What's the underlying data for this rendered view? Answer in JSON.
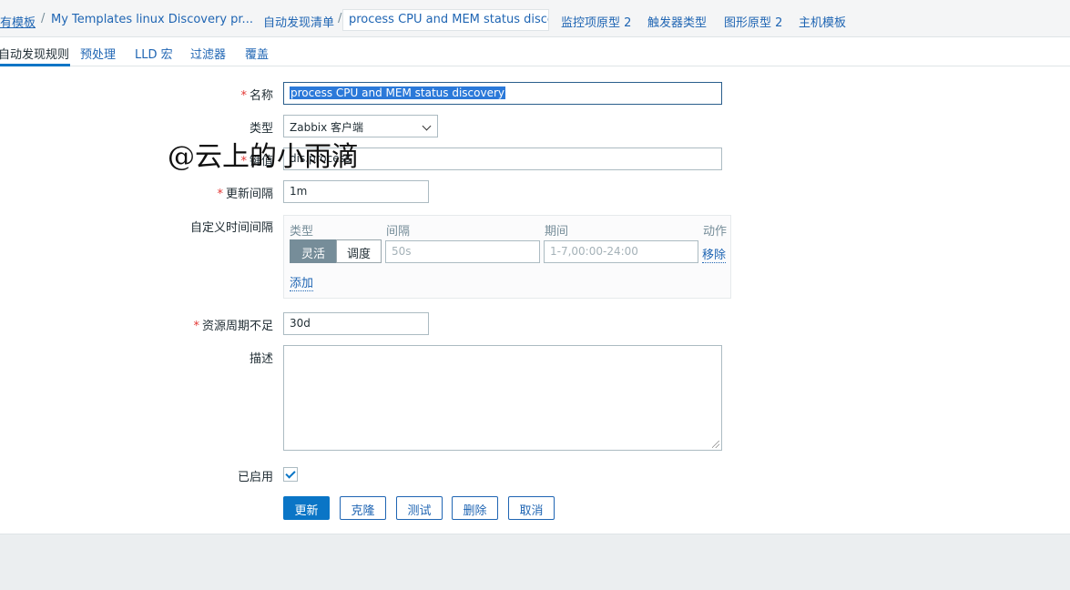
{
  "breadcrumb": {
    "all_templates": "有模板",
    "template": "My  Templates  linux  Discovery  pr...",
    "discovery_list": "自动发现清单",
    "current_rule": "process CPU and MEM status disco...",
    "item_prototypes": "监控项原型 2",
    "trigger_prototypes": "触发器类型",
    "graph_prototypes": "图形原型 2",
    "host_templates": "主机模板",
    "separator": "/"
  },
  "tabs": [
    {
      "label": "自动发现规则"
    },
    {
      "label": "预处理"
    },
    {
      "label": "LLD 宏"
    },
    {
      "label": "过滤器"
    },
    {
      "label": "覆盖"
    }
  ],
  "form": {
    "required_mark": "*",
    "name_label": "名称",
    "name_value": "process CPU and MEM status discovery",
    "type_label": "类型",
    "type_value": "Zabbix 客户端",
    "key_label": "键值",
    "key_value": "dis.process",
    "update_label": "更新间隔",
    "update_value": "1m",
    "custom_label": "自定义时间间隔",
    "custom_intervals": {
      "col_type": "类型",
      "col_interval": "间隔",
      "col_period": "期间",
      "col_action": "动作",
      "flexible": "灵活",
      "scheduling": "调度",
      "interval_placeholder": "50s",
      "period_placeholder": "1-7,00:00-24:00",
      "remove": "移除",
      "add": "添加"
    },
    "lifetime_label": "资源周期不足",
    "lifetime_value": "30d",
    "description_label": "描述",
    "description_value": "",
    "enabled_label": "已启用",
    "enabled": true
  },
  "buttons": {
    "update": "更新",
    "clone": "克隆",
    "test": "测试",
    "delete": "删除",
    "cancel": "取消"
  },
  "watermark": "@云上的小雨滴",
  "colors": {
    "accent": "#0a75c6",
    "link": "#1f65b3",
    "required": "#e33734",
    "selection": "#2b79d9"
  }
}
